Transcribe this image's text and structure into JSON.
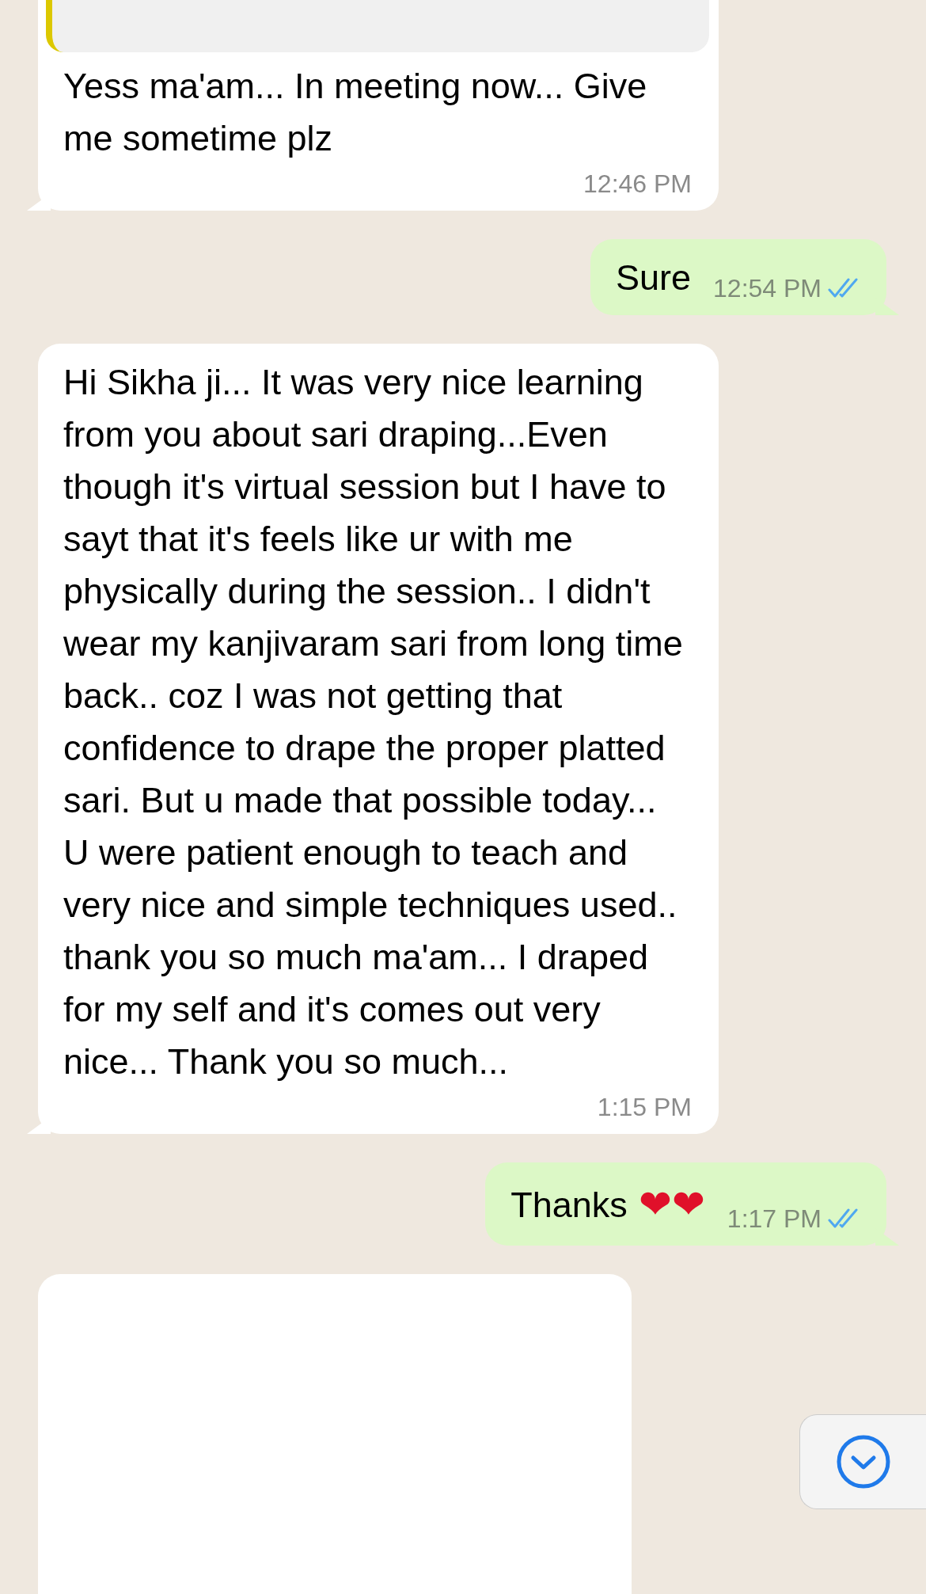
{
  "messages": [
    {
      "kind": "received",
      "quoted": true,
      "text": "Yess ma'am... In meeting now... Give me sometime plz",
      "time": "12:46 PM"
    },
    {
      "kind": "sent",
      "text": "Sure",
      "time": "12:54 PM",
      "read": true
    },
    {
      "kind": "received",
      "quoted": false,
      "text": "Hi Sikha ji... It was very nice learning from you about sari draping...Even though it's virtual session but I have to sayt that it's feels like ur with me physically during the session.. I didn't wear my kanjivaram sari from long time back.. coz I was not getting that confidence to drape the proper platted sari. But u made that possible today... U were patient enough to teach and very nice and simple techniques used.. thank you so much ma'am... I draped for my self and it's comes out very nice... Thank you so much...",
      "time": "1:15 PM"
    },
    {
      "kind": "sent",
      "text": "Thanks",
      "emoji": "❤❤",
      "time": "1:17 PM",
      "read": true
    },
    {
      "kind": "blank"
    }
  ]
}
